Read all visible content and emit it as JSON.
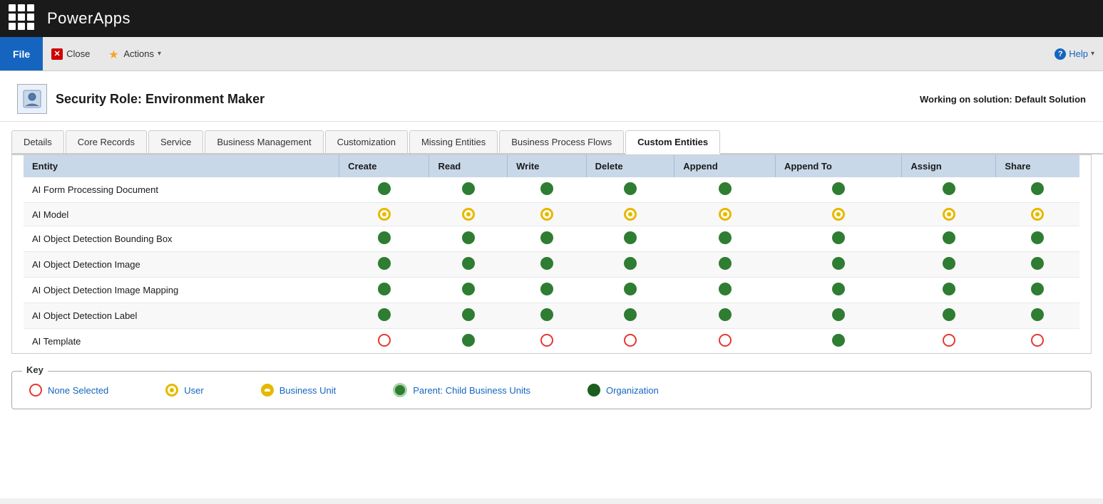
{
  "topBar": {
    "appName": "PowerApps"
  },
  "toolbar": {
    "fileLabel": "File",
    "closeLabel": "Close",
    "actionsLabel": "Actions",
    "helpLabel": "Help"
  },
  "pageHeader": {
    "title": "Security Role: Environment Maker",
    "solutionLabel": "Working on solution: Default Solution"
  },
  "tabs": [
    {
      "id": "details",
      "label": "Details",
      "active": false
    },
    {
      "id": "core-records",
      "label": "Core Records",
      "active": false
    },
    {
      "id": "service",
      "label": "Service",
      "active": false
    },
    {
      "id": "business-management",
      "label": "Business Management",
      "active": false
    },
    {
      "id": "customization",
      "label": "Customization",
      "active": false
    },
    {
      "id": "missing-entities",
      "label": "Missing Entities",
      "active": false
    },
    {
      "id": "business-process-flows",
      "label": "Business Process Flows",
      "active": false
    },
    {
      "id": "custom-entities",
      "label": "Custom Entities",
      "active": true
    }
  ],
  "table": {
    "columns": [
      "Entity",
      "Create",
      "Read",
      "Write",
      "Delete",
      "Append",
      "Append To",
      "Assign",
      "Share"
    ],
    "rows": [
      {
        "entity": "AI Form Processing Document",
        "create": "org",
        "read": "org",
        "write": "org",
        "delete": "org",
        "append": "org",
        "appendTo": "org",
        "assign": "org",
        "share": "org"
      },
      {
        "entity": "AI Model",
        "create": "user",
        "read": "user",
        "write": "user",
        "delete": "user",
        "append": "user",
        "appendTo": "user",
        "assign": "user",
        "share": "user"
      },
      {
        "entity": "AI Object Detection Bounding Box",
        "create": "org",
        "read": "org",
        "write": "org",
        "delete": "org",
        "append": "org",
        "appendTo": "org",
        "assign": "org",
        "share": "org"
      },
      {
        "entity": "AI Object Detection Image",
        "create": "org",
        "read": "org",
        "write": "org",
        "delete": "org",
        "append": "org",
        "appendTo": "org",
        "assign": "org",
        "share": "org"
      },
      {
        "entity": "AI Object Detection Image Mapping",
        "create": "org",
        "read": "org",
        "write": "org",
        "delete": "org",
        "append": "org",
        "appendTo": "org",
        "assign": "org",
        "share": "org"
      },
      {
        "entity": "AI Object Detection Label",
        "create": "org",
        "read": "org",
        "write": "org",
        "delete": "org",
        "append": "org",
        "appendTo": "org",
        "assign": "org",
        "share": "org"
      },
      {
        "entity": "AI Template",
        "create": "none",
        "read": "org",
        "write": "none",
        "delete": "none",
        "append": "none",
        "appendTo": "org",
        "assign": "none",
        "share": "none"
      }
    ]
  },
  "key": {
    "title": "Key",
    "items": [
      {
        "id": "none",
        "label": "None Selected"
      },
      {
        "id": "user",
        "label": "User"
      },
      {
        "id": "bu",
        "label": "Business Unit"
      },
      {
        "id": "parent",
        "label": "Parent: Child Business Units"
      },
      {
        "id": "org",
        "label": "Organization"
      }
    ]
  }
}
